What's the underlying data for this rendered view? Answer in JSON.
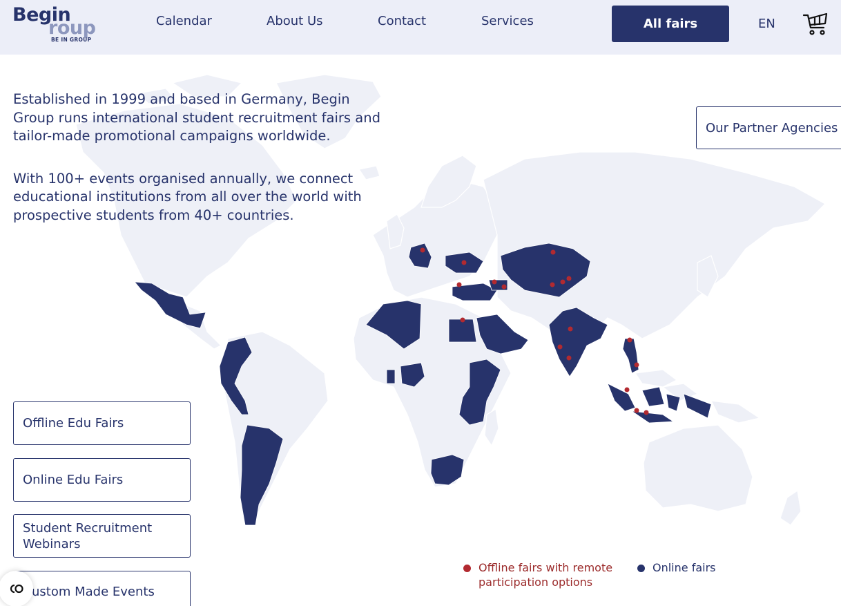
{
  "header": {
    "logo": {
      "word1": "Begin",
      "word2": "roup",
      "tagline": "BE IN GROUP"
    },
    "nav": [
      {
        "label": "Calendar"
      },
      {
        "label": "About Us"
      },
      {
        "label": "Contact"
      },
      {
        "label": "Services"
      }
    ],
    "cta_label": "All fairs",
    "language": "EN",
    "cart_icon": "shopping-cart-icon"
  },
  "intro": {
    "paragraph1": "Established in 1999 and based in Germany, Begin Group runs international student recruitment fairs and tailor-made promotional campaigns worldwide.",
    "paragraph2": "With 100+ events organised annually, we connect educational institutions from all over the world with prospective students from 40+ countries."
  },
  "partner_agencies_label": "Our Partner Agencies",
  "categories": [
    {
      "label": "Offline Edu Fairs"
    },
    {
      "label": "Online Edu Fairs"
    },
    {
      "label": "Student Recruitment Webinars"
    },
    {
      "label": "ustom Made Events"
    }
  ],
  "legend": {
    "offline_label": "Offline fairs with remote participation options",
    "online_label": "Online fairs"
  },
  "colors": {
    "brand_navy": "#27336b",
    "header_bg": "#eceef8",
    "land": "#eef0f7",
    "marker_red": "#b22a30",
    "offline_text": "#9b2a2a"
  },
  "cookie_icon": "cookie-settings-icon"
}
